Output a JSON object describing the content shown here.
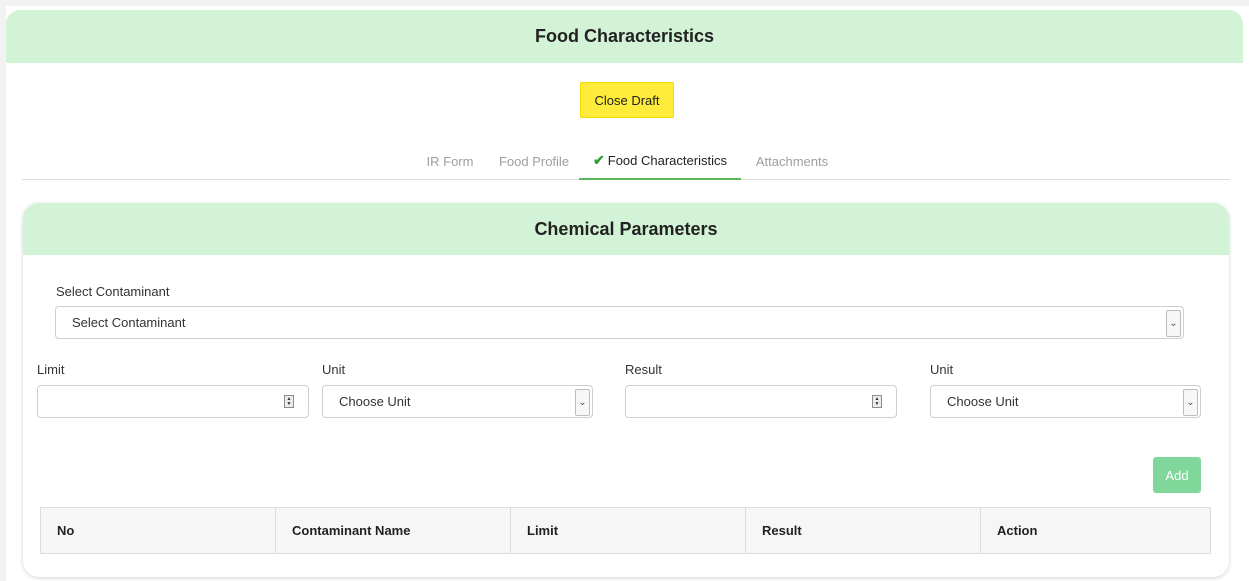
{
  "header": {
    "title": "Food Characteristics"
  },
  "actions": {
    "close_draft": "Close Draft"
  },
  "tabs": [
    {
      "label": "IR Form",
      "active": false
    },
    {
      "label": "Food Profile",
      "active": false
    },
    {
      "label": "Food Characteristics",
      "active": true,
      "icon": "check-icon"
    },
    {
      "label": "Attachments",
      "active": false
    }
  ],
  "card": {
    "title": "Chemical Parameters",
    "contaminant": {
      "label": "Select Contaminant",
      "selected": "Select Contaminant"
    },
    "limit": {
      "label": "Limit",
      "value": ""
    },
    "limit_unit": {
      "label": "Unit",
      "selected": "Choose Unit"
    },
    "result": {
      "label": "Result",
      "value": ""
    },
    "result_unit": {
      "label": "Unit",
      "selected": "Choose Unit"
    },
    "add_label": "Add",
    "table": {
      "columns": [
        "No",
        "Contaminant Name",
        "Limit",
        "Result",
        "Action"
      ],
      "rows": []
    }
  },
  "colors": {
    "header_bg": "#d2f3d5",
    "close_draft_bg": "#ffeb3b",
    "add_button_bg": "#7fd79a",
    "active_tab_underline": "#5cb85c",
    "check_icon": "#2e9d32"
  }
}
